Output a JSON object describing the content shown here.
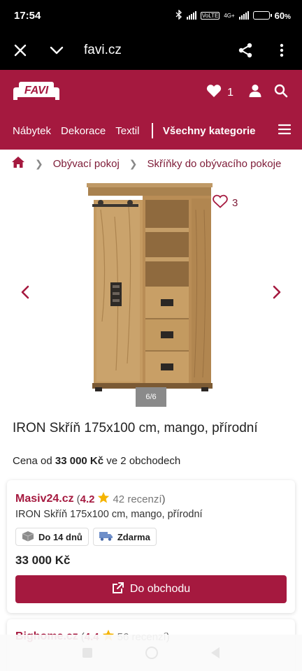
{
  "status_bar": {
    "time": "17:54",
    "battery": "60",
    "battery_pct": 0.6,
    "network": "4G+"
  },
  "browser": {
    "url": "favi.cz"
  },
  "header": {
    "logo_text": "FAVI",
    "favorites_count": "1",
    "nav": [
      "Nábytek",
      "Dekorace",
      "Textil"
    ],
    "all_categories": "Všechny kategorie"
  },
  "breadcrumb": [
    "Obývací pokoj",
    "Skříňky do obývacího pokoje"
  ],
  "gallery": {
    "favorites": "3",
    "counter": "6/6"
  },
  "product": {
    "title": "IRON Skříň 175x100 cm, mango, přírodní",
    "price_prefix": "Cena od",
    "price": "33 000 Kč",
    "price_suffix": "ve 2 obchodech"
  },
  "offers": [
    {
      "shop": "Masiv24.cz",
      "rating": "4.2",
      "reviews": "42 recenzí",
      "product_name": "IRON Skříň 175x100 cm, mango, přírodní",
      "delivery": "Do 14 dnů",
      "shipping": "Zdarma",
      "price": "33 000 Kč",
      "button": "Do obchodu"
    },
    {
      "shop": "Bighome.cz",
      "rating": "4.4",
      "reviews": "56 recenzí"
    }
  ],
  "colors": {
    "brand": "#a5193f",
    "star": "#f5b400"
  }
}
